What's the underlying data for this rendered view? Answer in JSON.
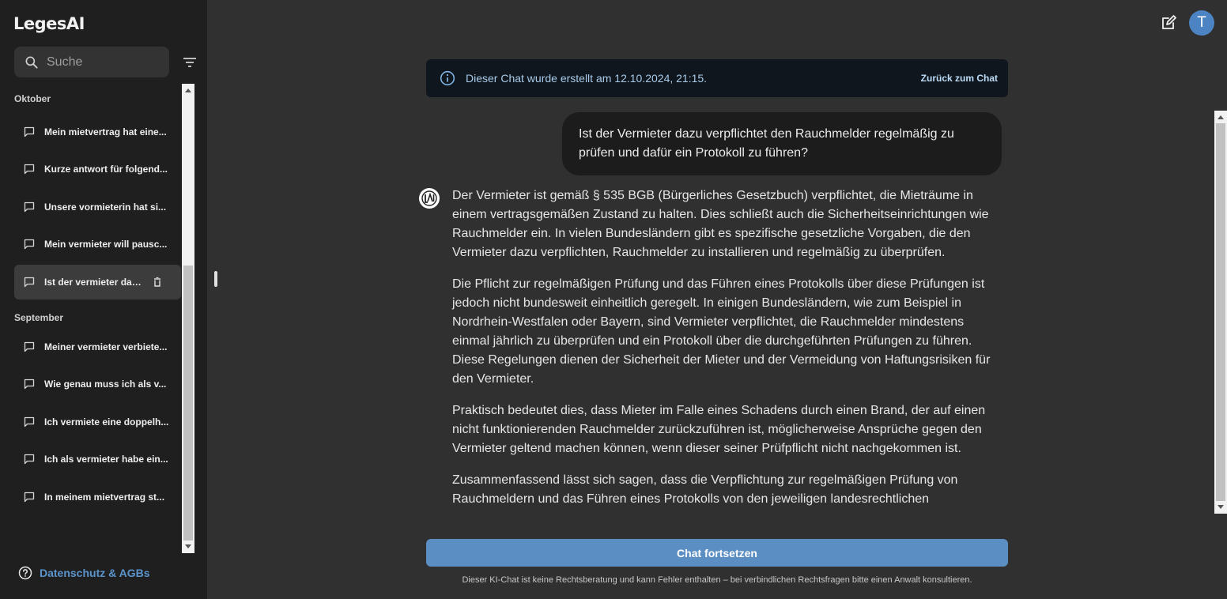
{
  "app": {
    "logo_text": "LegesAI"
  },
  "sidebar": {
    "search_placeholder": "Suche",
    "groups": [
      {
        "label": "Oktober"
      },
      {
        "label": "September"
      }
    ],
    "items": [
      {
        "label": "Mein mietvertrag hat eine..."
      },
      {
        "label": "Kurze antwort für folgend..."
      },
      {
        "label": "Unsere vormieterin hat si..."
      },
      {
        "label": "Mein vermieter will pausc..."
      },
      {
        "label": "Ist der vermieter dazu ...",
        "active": true
      },
      {
        "label": "Meiner vermieter verbiete..."
      },
      {
        "label": "Wie genau muss ich als v..."
      },
      {
        "label": "Ich vermiete eine doppelh..."
      },
      {
        "label": "Ich als vermieter habe ein..."
      },
      {
        "label": "In meinem mietvertrag st..."
      }
    ],
    "footer_link": "Datenschutz & AGBs"
  },
  "header": {
    "avatar_initial": "T"
  },
  "banner": {
    "message": "Dieser Chat wurde erstellt am 12.10.2024, 21:15.",
    "back_label": "Zurück zum Chat"
  },
  "chat": {
    "user_message": "Ist der Vermieter dazu verpflichtet den Rauchmelder regelmäßig zu prüfen und dafür ein Protokoll zu führen?",
    "assistant_paragraphs": [
      "Der Vermieter ist gemäß § 535 BGB (Bürgerliches Gesetzbuch) verpflichtet, die Mieträume in einem vertragsgemäßen Zustand zu halten. Dies schließt auch die Sicherheitseinrichtungen wie Rauchmelder ein. In vielen Bundesländern gibt es spezifische gesetzliche Vorgaben, die den Vermieter dazu verpflichten, Rauchmelder zu installieren und regelmäßig zu überprüfen.",
      "Die Pflicht zur regelmäßigen Prüfung und das Führen eines Protokolls über diese Prüfungen ist jedoch nicht bundesweit einheitlich geregelt. In einigen Bundesländern, wie zum Beispiel in Nordrhein-Westfalen oder Bayern, sind Vermieter verpflichtet, die Rauchmelder mindestens einmal jährlich zu überprüfen und ein Protokoll über die durchgeführten Prüfungen zu führen. Diese Regelungen dienen der Sicherheit der Mieter und der Vermeidung von Haftungsrisiken für den Vermieter.",
      "Praktisch bedeutet dies, dass Mieter im Falle eines Schadens durch einen Brand, der auf einen nicht funktionierenden Rauchmelder zurückzuführen ist, möglicherweise Ansprüche gegen den Vermieter geltend machen können, wenn dieser seiner Prüfpflicht nicht nachgekommen ist.",
      "Zusammenfassend lässt sich sagen, dass die Verpflichtung zur regelmäßigen Prüfung von Rauchmeldern und das Führen eines Protokolls von den jeweiligen landesrechtlichen"
    ]
  },
  "continue_label": "Chat fortsetzen",
  "disclaimer": "Dieser KI-Chat ist keine Rechtsberatung und kann Fehler enthalten – bei verbindlichen Rechtsfragen bitte einen Anwalt konsultieren.",
  "colors": {
    "accent": "#5b8ec3",
    "avatar": "#4c83c2",
    "link": "#5b95cc",
    "banner_bg": "#0f161d"
  }
}
